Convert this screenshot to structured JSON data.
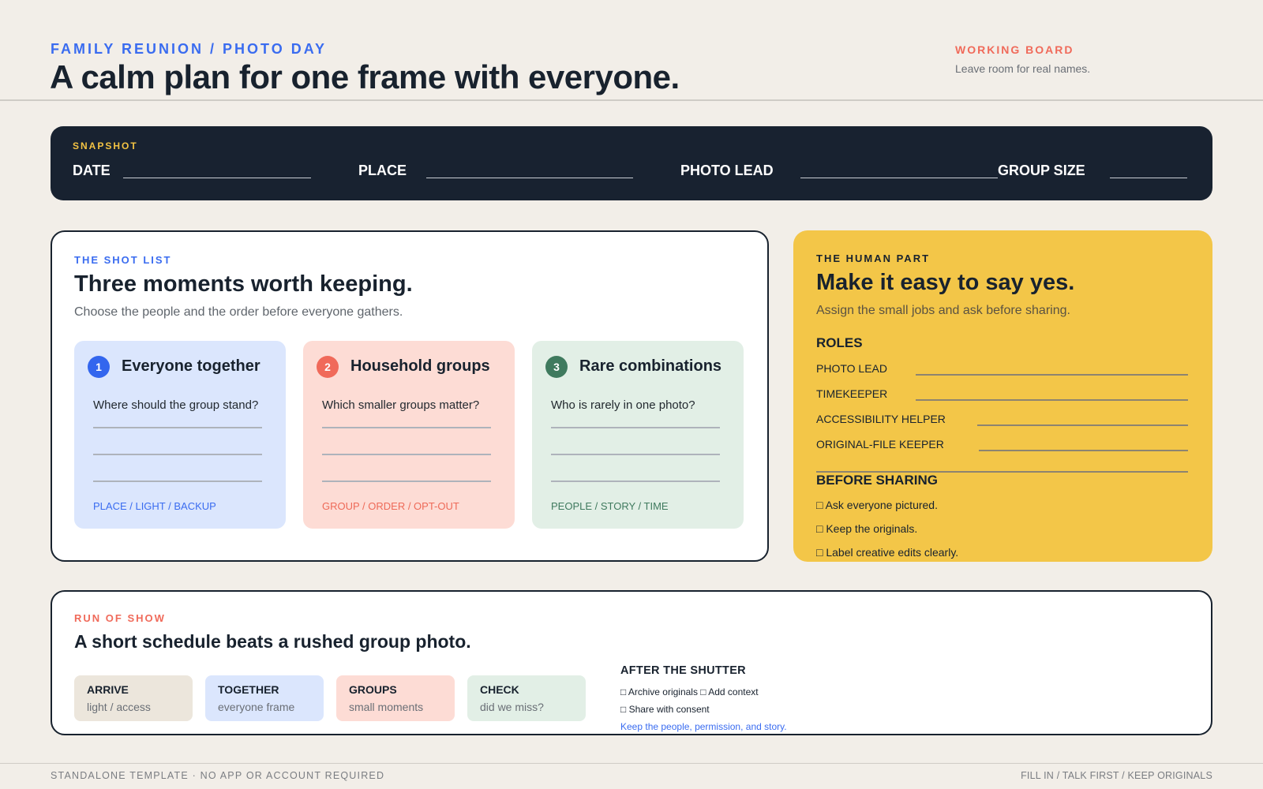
{
  "header": {
    "eyebrow": "FAMILY REUNION / PHOTO DAY",
    "title": "A calm plan for one frame with everyone.",
    "status_label": "WORKING BOARD",
    "status_note": "Leave room for real names."
  },
  "snapshot": {
    "eyebrow": "SNAPSHOT",
    "fields": [
      "DATE",
      "PLACE",
      "PHOTO LEAD",
      "GROUP SIZE"
    ]
  },
  "shot_list": {
    "eyebrow": "THE SHOT LIST",
    "title": "Three moments worth keeping.",
    "subtitle": "Choose the people and the order before everyone gathers.",
    "moments": [
      {
        "number": "1",
        "title": "Everyone together",
        "question": "Where should the group stand?",
        "tags": "PLACE / LIGHT / BACKUP",
        "accent": "#3366ee",
        "tag_color": "#3a6cf0"
      },
      {
        "number": "2",
        "title": "Household groups",
        "question": "Which smaller groups matter?",
        "tags": "GROUP / ORDER / OPT-OUT",
        "accent": "#f06a5a",
        "tag_color": "#ee6a58"
      },
      {
        "number": "3",
        "title": "Rare combinations",
        "question": "Who is rarely in one photo?",
        "tags": "PEOPLE / STORY / TIME",
        "accent": "#3f7a5e",
        "tag_color": "#3f7a5e"
      }
    ]
  },
  "human_part": {
    "eyebrow": "THE HUMAN PART",
    "title": "Make it easy to say yes.",
    "subtitle": "Assign the small jobs and ask before sharing.",
    "roles_heading": "ROLES",
    "roles": [
      "PHOTO LEAD",
      "TIMEKEEPER",
      "ACCESSIBILITY HELPER",
      "ORIGINAL-FILE KEEPER"
    ],
    "sharing_heading": "BEFORE SHARING",
    "sharing_items": [
      "□ Ask everyone pictured.",
      "□ Keep the originals.",
      "□ Label creative edits clearly."
    ]
  },
  "run_of_show": {
    "eyebrow": "RUN OF SHOW",
    "title": "A short schedule beats a rushed group photo.",
    "steps": [
      {
        "label": "ARRIVE",
        "sub": "light / access",
        "bg": "#ece6dc"
      },
      {
        "label": "TOGETHER",
        "sub": "everyone frame",
        "bg": "#dbe6fd"
      },
      {
        "label": "GROUPS",
        "sub": "small moments",
        "bg": "#fddcd5"
      },
      {
        "label": "CHECK",
        "sub": "did we miss?",
        "bg": "#e2efe6"
      }
    ],
    "after_heading": "AFTER THE SHUTTER",
    "after_items": [
      "□ Archive originals □ Add context",
      "□ Share with consent"
    ],
    "after_note": "Keep the people, permission, and story."
  },
  "footer": {
    "left": "STANDALONE TEMPLATE · NO APP OR ACCOUNT REQUIRED",
    "right": "FILL IN / TALK FIRST / KEEP ORIGINALS"
  },
  "colors": {
    "background": "#f2eee8",
    "navy": "#182230",
    "blue": "#3a6cf0",
    "coral": "#f06a5a",
    "green": "#3f7a5e",
    "yellow": "#f3c648"
  }
}
